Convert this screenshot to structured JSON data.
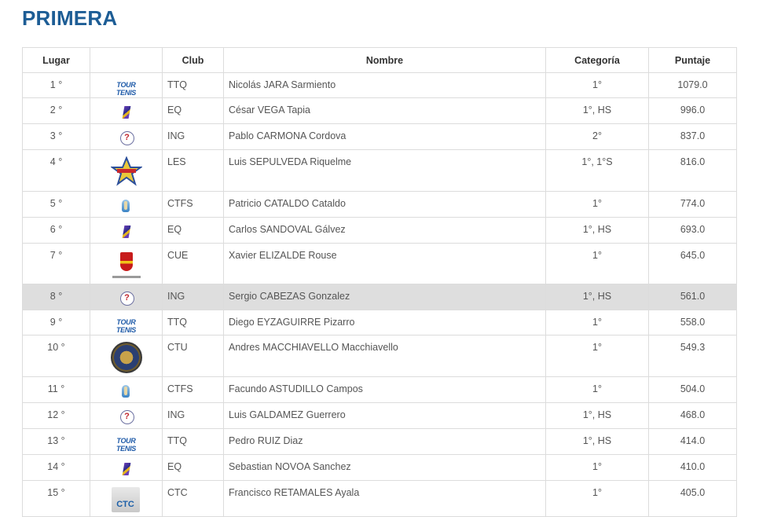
{
  "page": {
    "title": "PRIMERA"
  },
  "table": {
    "headers": {
      "lugar": "Lugar",
      "logo": "",
      "club": "Club",
      "nombre": "Nombre",
      "categoria": "Categoría",
      "puntaje": "Puntaje"
    },
    "rows": [
      {
        "lugar": "1 °",
        "logo": "tourtenis-logo-icon",
        "logo_text": "TOUR TENIS",
        "club": "TTQ",
        "nombre": "Nicolás JARA Sarmiento",
        "categoria": "1°",
        "puntaje": "1079.0"
      },
      {
        "lugar": "2 °",
        "logo": "eq-logo-icon",
        "club": "EQ",
        "nombre": "César VEGA Tapia",
        "categoria": "1°, HS",
        "puntaje": "996.0"
      },
      {
        "lugar": "3 °",
        "logo": "ing-logo-icon",
        "club": "ING",
        "nombre": "Pablo CARMONA Cordova",
        "categoria": "2°",
        "puntaje": "837.0"
      },
      {
        "lugar": "4 °",
        "logo": "les-star-logo-icon",
        "club": "LES",
        "nombre": "Luis SEPULVEDA Riquelme",
        "categoria": "1°, 1°S",
        "puntaje": "816.0"
      },
      {
        "lugar": "5 °",
        "logo": "ctfs-logo-icon",
        "club": "CTFS",
        "nombre": "Patricio CATALDO Cataldo",
        "categoria": "1°",
        "puntaje": "774.0"
      },
      {
        "lugar": "6 °",
        "logo": "eq-logo-icon",
        "club": "EQ",
        "nombre": "Carlos SANDOVAL Gálvez",
        "categoria": "1°, HS",
        "puntaje": "693.0"
      },
      {
        "lugar": "7 °",
        "logo": "cue-crest-logo-icon",
        "club": "CUE",
        "nombre": "Xavier ELIZALDE Rouse",
        "categoria": "1°",
        "puntaje": "645.0"
      },
      {
        "lugar": "8 °",
        "logo": "ing-logo-icon",
        "club": "ING",
        "nombre": "Sergio CABEZAS Gonzalez",
        "categoria": "1°, HS",
        "puntaje": "561.0",
        "highlighted": true
      },
      {
        "lugar": "9 °",
        "logo": "tourtenis-logo-icon",
        "logo_text": "TOUR TENIS",
        "club": "TTQ",
        "nombre": "Diego EYZAGUIRRE Pizarro",
        "categoria": "1°",
        "puntaje": "558.0"
      },
      {
        "lugar": "10 °",
        "logo": "ctu-seal-logo-icon",
        "club": "CTU",
        "nombre": "Andres MACCHIAVELLO Macchiavello",
        "categoria": "1°",
        "puntaje": "549.3"
      },
      {
        "lugar": "11 °",
        "logo": "ctfs-logo-icon",
        "club": "CTFS",
        "nombre": "Facundo ASTUDILLO Campos",
        "categoria": "1°",
        "puntaje": "504.0"
      },
      {
        "lugar": "12 °",
        "logo": "ing-logo-icon",
        "club": "ING",
        "nombre": "Luis GALDAMEZ Guerrero",
        "categoria": "1°, HS",
        "puntaje": "468.0"
      },
      {
        "lugar": "13 °",
        "logo": "tourtenis-logo-icon",
        "logo_text": "TOUR TENIS",
        "club": "TTQ",
        "nombre": "Pedro RUIZ Diaz",
        "categoria": "1°, HS",
        "puntaje": "414.0"
      },
      {
        "lugar": "14 °",
        "logo": "eq-logo-icon",
        "club": "EQ",
        "nombre": "Sebastian NOVOA Sanchez",
        "categoria": "1°",
        "puntaje": "410.0"
      },
      {
        "lugar": "15 °",
        "logo": "ctc-logo-icon",
        "logo_text": "CTC",
        "club": "CTC",
        "nombre": "Francisco RETAMALES Ayala",
        "categoria": "1°",
        "puntaje": "405.0"
      }
    ]
  },
  "colors": {
    "title": "#1d5d95",
    "highlight_row": "#dedede",
    "border": "#dcdcdc"
  }
}
